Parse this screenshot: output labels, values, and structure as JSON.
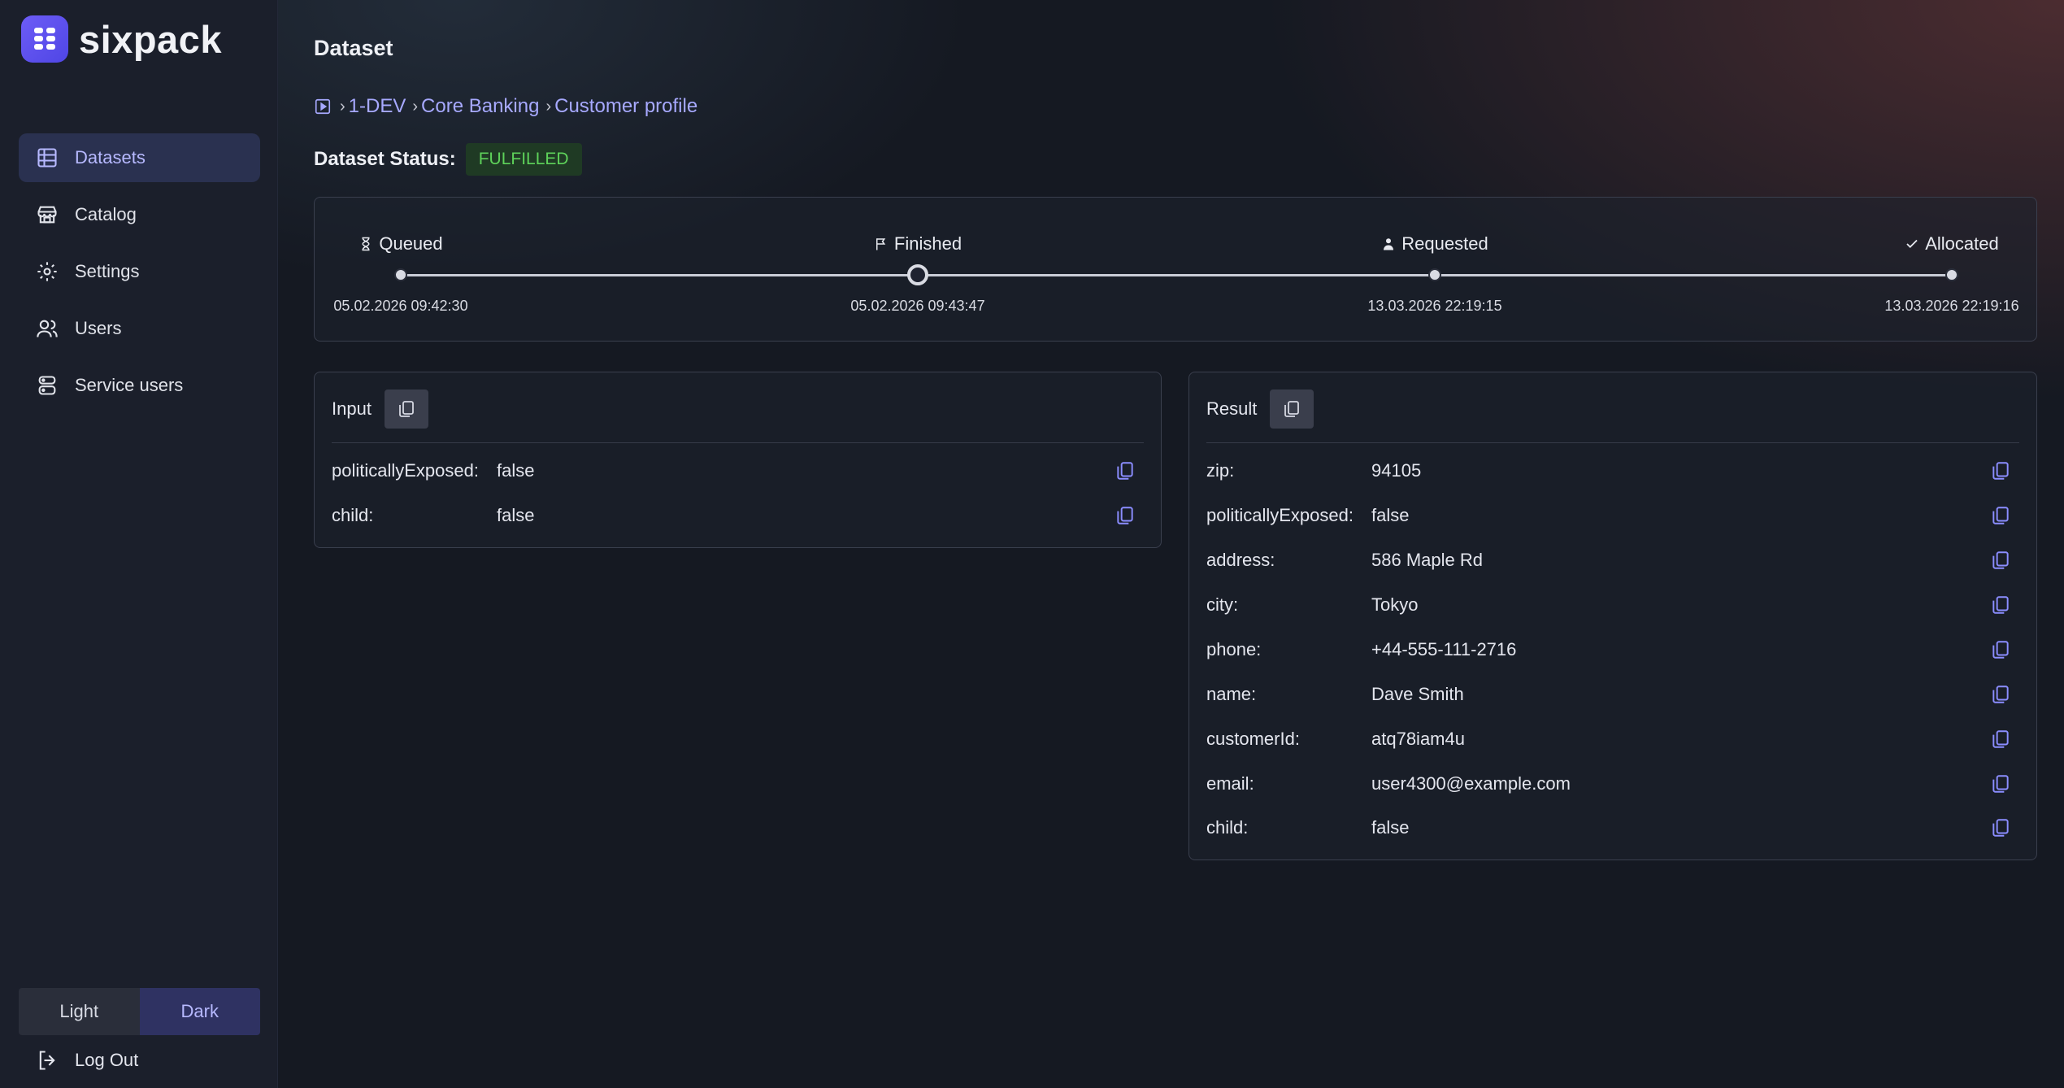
{
  "app": {
    "name": "sixpack"
  },
  "sidebar": {
    "items": [
      {
        "label": "Datasets",
        "icon": "table-icon",
        "active": true
      },
      {
        "label": "Catalog",
        "icon": "store-icon",
        "active": false
      },
      {
        "label": "Settings",
        "icon": "gear-icon",
        "active": false
      },
      {
        "label": "Users",
        "icon": "users-icon",
        "active": false
      },
      {
        "label": "Service users",
        "icon": "server-user-icon",
        "active": false
      }
    ],
    "theme": {
      "light": "Light",
      "dark": "Dark",
      "selected": "Dark"
    },
    "logout": "Log Out"
  },
  "page": {
    "title": "Dataset",
    "breadcrumb": [
      "1-DEV",
      "Core Banking",
      "Customer profile"
    ],
    "status_label": "Dataset Status:",
    "status": "FULFILLED"
  },
  "timeline": {
    "steps": [
      {
        "label": "Queued",
        "icon": "hourglass-icon",
        "time": "05.02.2026 09:42:30"
      },
      {
        "label": "Finished",
        "icon": "flag-icon",
        "time": "05.02.2026 09:43:47"
      },
      {
        "label": "Requested",
        "icon": "person-icon",
        "time": "13.03.2026 22:19:15"
      },
      {
        "label": "Allocated",
        "icon": "check-icon",
        "time": "13.03.2026 22:19:16"
      }
    ]
  },
  "input": {
    "title": "Input",
    "rows": [
      {
        "key": "politicallyExposed:",
        "value": "false"
      },
      {
        "key": "child:",
        "value": "false"
      }
    ]
  },
  "result": {
    "title": "Result",
    "rows": [
      {
        "key": "zip:",
        "value": "94105"
      },
      {
        "key": "politicallyExposed:",
        "value": "false"
      },
      {
        "key": "address:",
        "value": "586 Maple Rd"
      },
      {
        "key": "city:",
        "value": "Tokyo"
      },
      {
        "key": "phone:",
        "value": "+44-555-111-2716"
      },
      {
        "key": "name:",
        "value": "Dave Smith"
      },
      {
        "key": "customerId:",
        "value": "atq78iam4u"
      },
      {
        "key": "email:",
        "value": "user4300@example.com"
      },
      {
        "key": "child:",
        "value": "false"
      }
    ]
  },
  "colors": {
    "accent": "#a7a9ff",
    "status_ok": "#5ed25a",
    "brand": "#6d5cf6"
  }
}
